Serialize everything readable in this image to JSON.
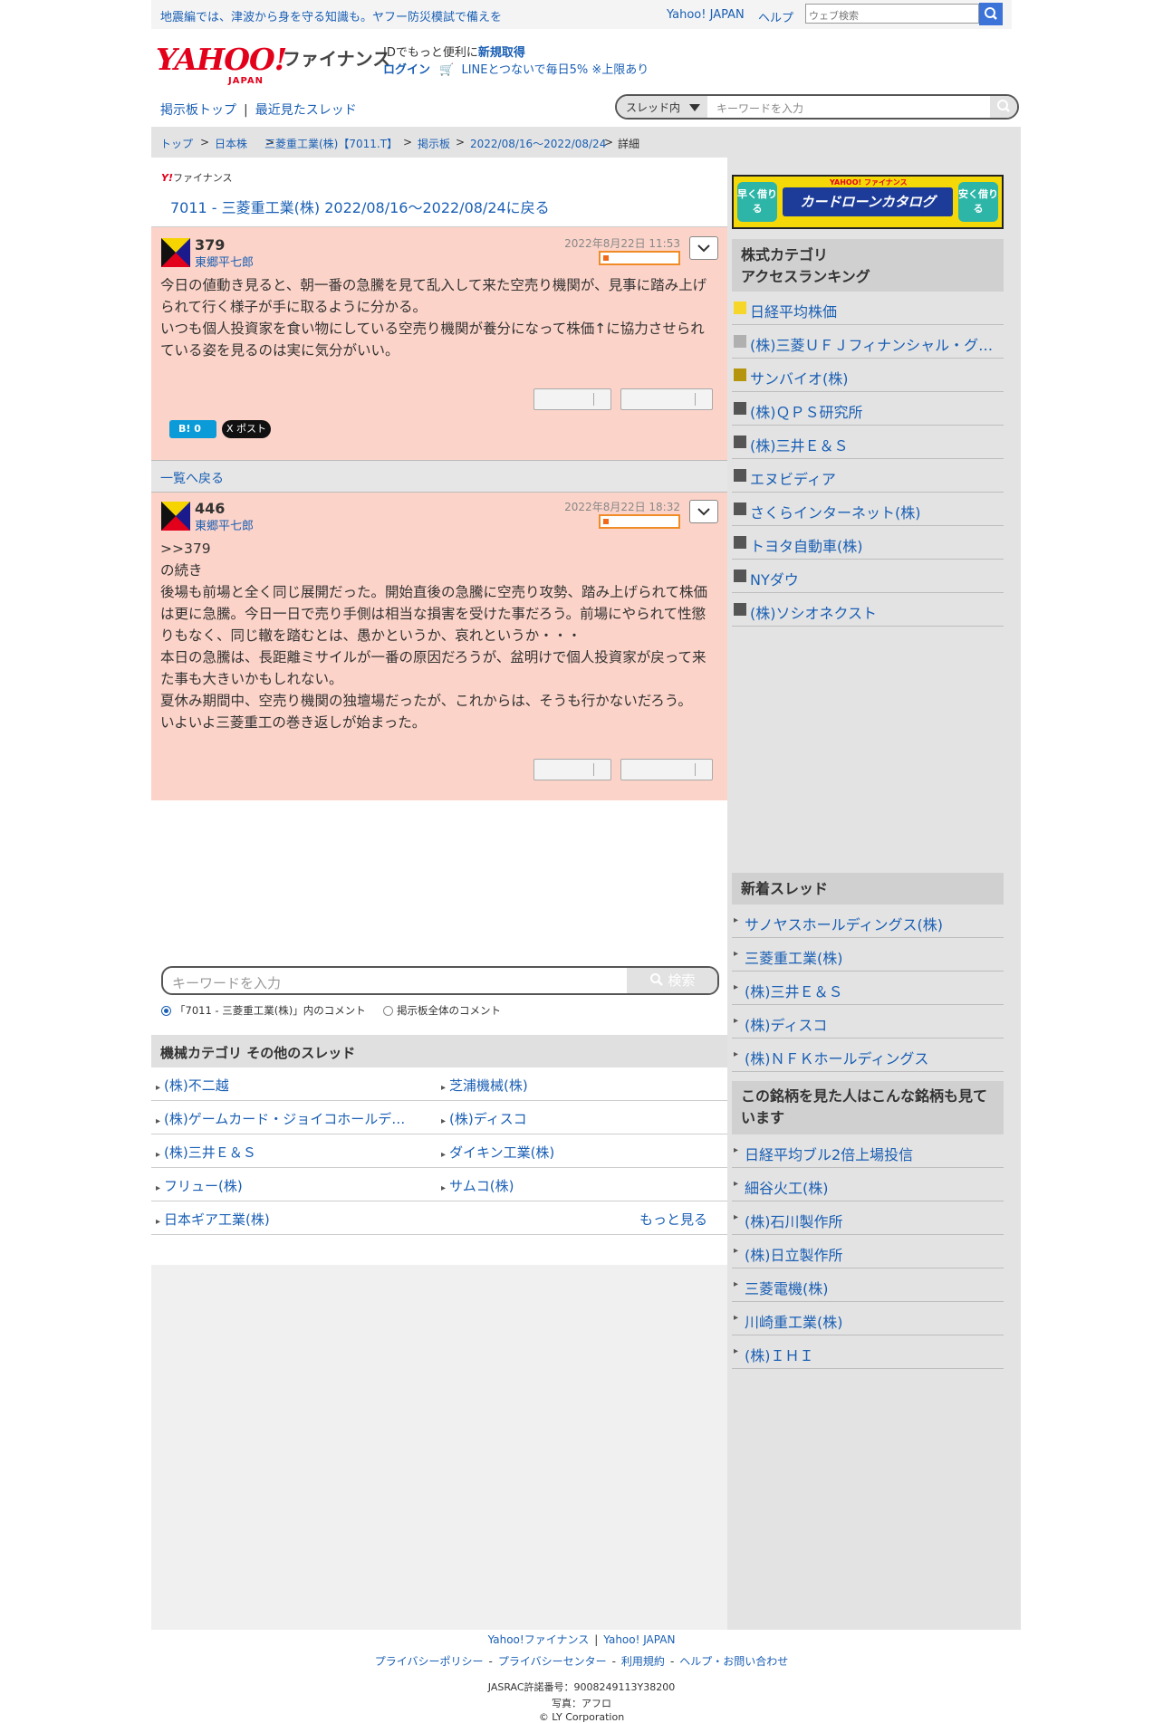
{
  "topbar": {
    "notice": "地震編では、津波から身を守る知識も。ヤフー防災模試で備えを",
    "yahoo_japan": "Yahoo! JAPAN",
    "help": "ヘルプ",
    "web_search_placeholder": "ウェブ検索",
    "search_icon": "search-icon"
  },
  "header": {
    "logo_text": "YAHOO!",
    "logo_sub": "JAPAN",
    "service_name": "ファイナンス",
    "id_prefix": "IDでもっと便利に",
    "id_link": "新規取得",
    "login": "ログイン",
    "promo": "LINEとつないで毎日5% ※上限あり"
  },
  "subnav": {
    "board_top": "掲示板トップ",
    "sep": "|",
    "recent": "最近見たスレッド",
    "scope_select": "スレッド内",
    "keyword_placeholder": "キーワードを入力"
  },
  "breadcrumb": {
    "items": [
      "トップ",
      "日本株",
      "三菱重工業(株)【7011.T】",
      "掲示板",
      "2022/08/16〜2022/08/24",
      "詳細"
    ],
    "sep": ">"
  },
  "main": {
    "mini_logo_y": "Y!",
    "mini_logo_text": "ファイナンス",
    "back_link": "7011 - 三菱重工業(株) 2022/08/16〜2022/08/24に戻る",
    "posts": [
      {
        "number": "379",
        "user": "東郷平七郎",
        "date": "2022年8月22日 11:53",
        "body": "今日の値動き見ると、朝一番の急騰を見て乱入して来た空売り機関が、見事に踏み上げられて行く様子が手に取るように分かる。\nいつも個人投資家を食い物にしている空売り機関が養分になって株価↑に協力させられている姿を見るのは実に気分がいい。"
      },
      {
        "number": "446",
        "user": "東郷平七郎",
        "date": "2022年8月22日 18:32",
        "body": ">>379\nの続き\n後場も前場と全く同じ展開だった。開始直後の急騰に空売り攻勢、踏み上げられて株価は更に急騰。今日一日で売り手側は相当な損害を受けた事だろう。前場にやられて性懲りもなく、同じ轍を踏むとは、愚かというか、哀れというか・・・\n本日の急騰は、長距離ミサイルが一番の原因だろうが、盆明けで個人投資家が戻って来た事も大きいかもしれない。\n夏休み期間中、空売り機関の独壇場だったが、これからは、そうも行かないだろう。\nいよいよ三菱重工の巻き返しが始まった。"
      }
    ],
    "hatena_label": "B! 0",
    "tweet_label": "X ポスト",
    "list_back": "一覧へ戻る",
    "keyword_placeholder": "キーワードを入力",
    "search_button": "検索",
    "radio_this": "「7011 - 三菱重工業(株)」内のコメント",
    "radio_all": "掲示板全体のコメント",
    "other_threads_title": "機械カテゴリ  その他のスレッド",
    "other_threads": [
      [
        "(株)不二越",
        "芝浦機械(株)"
      ],
      [
        "(株)ゲームカード・ジョイコホールデ…",
        "(株)ディスコ"
      ],
      [
        "(株)三井Ｅ＆Ｓ",
        "ダイキン工業(株)"
      ],
      [
        "フリュー(株)",
        "サムコ(株)"
      ]
    ],
    "last_thread": "日本ギア工業(株)",
    "more": "もっと見る"
  },
  "sidebar": {
    "banner_left": "早く借りる",
    "banner_mid": "カードローンカタログ",
    "banner_brand": "YAHOO! ファイナンス",
    "banner_right": "安く借りる",
    "ranking_title_1": "株式カテゴリ",
    "ranking_title_2": "アクセスランキング",
    "ranking": [
      {
        "label": "日経平均株価",
        "color": "#f5d629"
      },
      {
        "label": "(株)三菱ＵＦＪフィナンシャル・グ…",
        "color": "#b0b0b0"
      },
      {
        "label": "サンバイオ(株)",
        "color": "#b5950e"
      },
      {
        "label": "(株)ＱＰＳ研究所",
        "color": "#555555"
      },
      {
        "label": "(株)三井Ｅ＆Ｓ",
        "color": "#555555"
      },
      {
        "label": "エヌビディア",
        "color": "#555555"
      },
      {
        "label": "さくらインターネット(株)",
        "color": "#555555"
      },
      {
        "label": "トヨタ自動車(株)",
        "color": "#555555"
      },
      {
        "label": "NYダウ",
        "color": "#555555"
      },
      {
        "label": "(株)ソシオネクスト",
        "color": "#555555"
      }
    ],
    "new_threads_title": "新着スレッド",
    "new_threads": [
      "サノヤスホールディングス(株)",
      "三菱重工業(株)",
      "(株)三井Ｅ＆Ｓ",
      "(株)ディスコ",
      "(株)ＮＦＫホールディングス"
    ],
    "also_viewed_title": "この銘柄を見た人はこんな銘柄も見ています",
    "also_viewed": [
      "日経平均ブル2倍上場投信",
      "細谷火工(株)",
      "(株)石川製作所",
      "(株)日立製作所",
      "三菱電機(株)",
      "川崎重工業(株)",
      "(株)ＩＨＩ"
    ]
  },
  "footer": {
    "finance": "Yahoo!ファイナンス",
    "yahoo_japan": "Yahoo! JAPAN",
    "privacy_policy": "プライバシーポリシー",
    "privacy_center": "プライバシーセンター",
    "terms": "利用規約",
    "help_contact": "ヘルプ・お問い合わせ",
    "jasrac": "JASRAC許諾番号：9008249113Y38200",
    "photo": "写真：アフロ",
    "copyright": "© LY Corporation"
  }
}
